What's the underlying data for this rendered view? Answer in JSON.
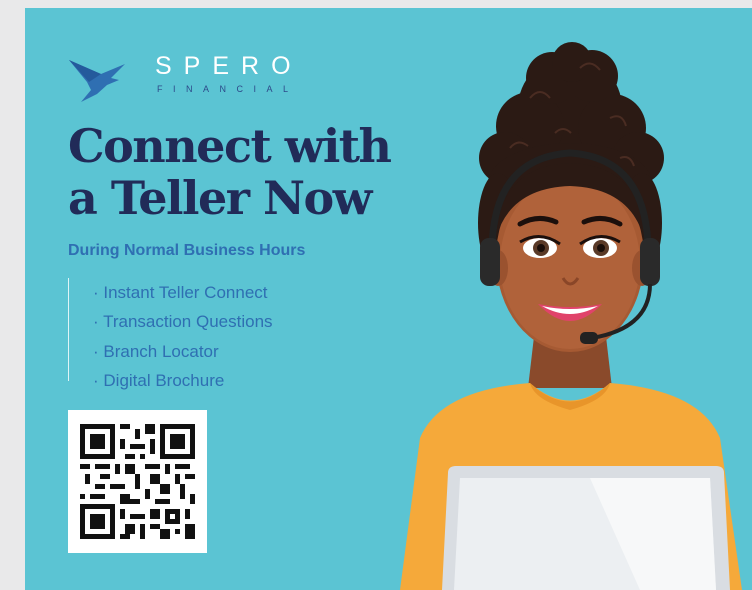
{
  "brand": {
    "name": "SPERO",
    "sub": "FINANCIAL",
    "logo_icon": "bird-icon"
  },
  "headline": {
    "line1": "Connect with",
    "line2": "a Teller Now"
  },
  "subhead": "During Normal Business Hours",
  "links": [
    "· Instant Teller Connect",
    "· Transaction Questions",
    "· Branch Locator",
    "· Digital Brochure"
  ],
  "qr_icon": "qr-code",
  "illustration": "woman-with-headset-and-laptop",
  "colors": {
    "background": "#5bc4d3",
    "headline": "#212b58",
    "accent_blue": "#2f6fb2",
    "shirt": "#f5a93a",
    "laptop": "#e8ebee"
  }
}
